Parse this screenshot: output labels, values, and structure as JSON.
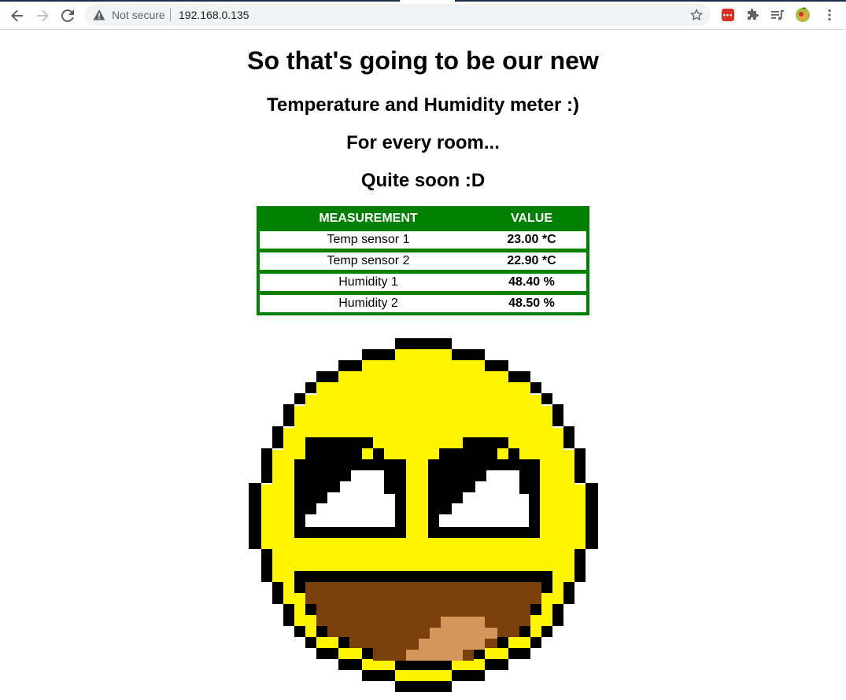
{
  "browser": {
    "security_label": "Not secure",
    "url": "192.168.0.135",
    "extension_red_label": "•••"
  },
  "page": {
    "title": "So that's going to be our new",
    "line1": "Temperature and Humidity meter :)",
    "line2": "For every room...",
    "line3": "Quite soon :D"
  },
  "table": {
    "headers": [
      "MEASUREMENT",
      "VALUE"
    ],
    "rows": [
      {
        "name": "Temp sensor 1",
        "value": "23.00 *C"
      },
      {
        "name": "Temp sensor 2",
        "value": "22.90 *C"
      },
      {
        "name": "Humidity 1",
        "value": "48.40 %"
      },
      {
        "name": "Humidity 2",
        "value": "48.50 %"
      }
    ],
    "colors": {
      "border": "#008000",
      "header_text": "#ffffff"
    }
  },
  "image": {
    "icon": "awesome-face-pixel-art",
    "colors": {
      "face": "#fff500",
      "outline": "#000000",
      "mouth": "#7a3f0a",
      "tongue": "#d4965a",
      "eyes": "#ffffff"
    }
  }
}
